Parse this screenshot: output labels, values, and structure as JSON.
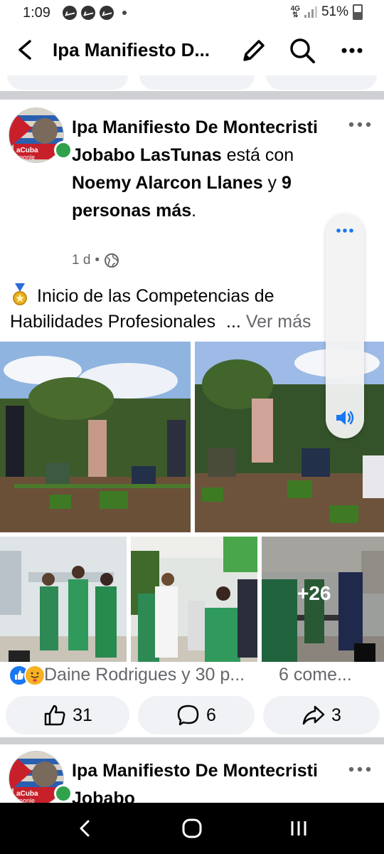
{
  "status_bar": {
    "time": "1:09",
    "network": "4G",
    "battery": "51%"
  },
  "app_bar": {
    "title": "Ipa Manifiesto D..."
  },
  "post": {
    "author": "Ipa Manifiesto De Montecristi Jobabo LasTunas",
    "with_text": " está con ",
    "tagged": "Noemy Alarcon Llanes",
    "and_text": " y ",
    "others": "9 personas más",
    "period": ".",
    "time": "1 d",
    "meta_sep": "•",
    "body": "Inicio de las Competencias de Habilidades Profesionales",
    "body_ellipsis": "...",
    "see_more": "Ver más",
    "photos_more": "+26",
    "reactions_text": "Daine Rodrigues y 30 p...",
    "comments_text": "6 come...",
    "like_count": "31",
    "comment_count": "6",
    "share_count": "3"
  },
  "next_post": {
    "author": "Ipa Manifiesto De Montecristi Jobabo"
  },
  "colors": {
    "fb_blue": "#1877f2",
    "online_green": "#31a24c",
    "button_bg": "#f0f2f5",
    "separator": "#ced0d4"
  },
  "icons": [
    "back-arrow-icon",
    "edit-pencil-icon",
    "search-icon",
    "more-dots-icon",
    "globe-icon",
    "medal-icon",
    "speaker-icon",
    "like-icon",
    "comment-icon",
    "share-icon",
    "nav-back-icon",
    "nav-home-icon",
    "nav-recents-icon"
  ]
}
